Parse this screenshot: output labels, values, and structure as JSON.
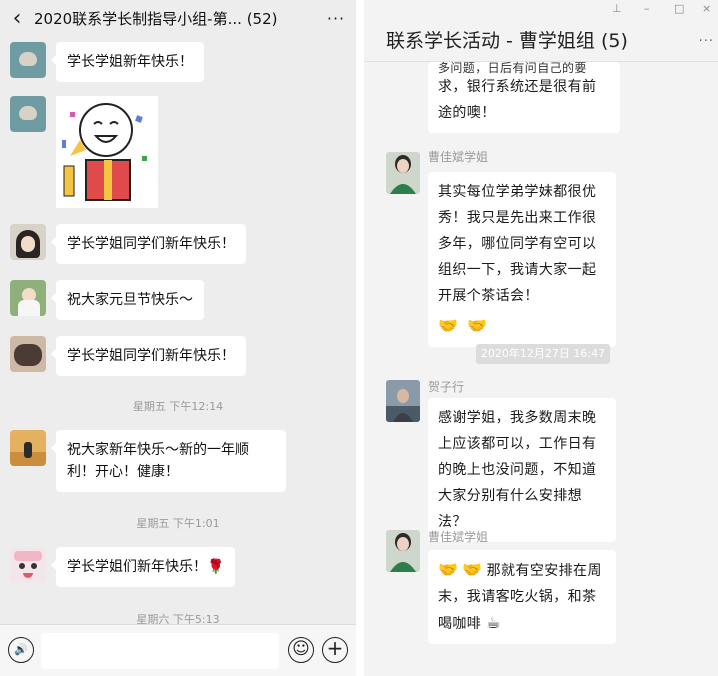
{
  "left": {
    "title": "2020联系学长制指导小组-第...",
    "count": "(52)",
    "back_glyph": "‹",
    "more_glyph": "···",
    "messages": [
      {
        "text": "学长学姐新年快乐！"
      },
      {
        "text": "学长学姐同学们新年快乐！"
      },
      {
        "text": "祝大家元旦节快乐～"
      },
      {
        "text": "学长学姐同学们新年快乐！"
      },
      {
        "text": "祝大家新年快乐～新的一年顺利！开心！健康！"
      },
      {
        "text": "学长学姐们新年快乐！🌹"
      }
    ],
    "timestamps": [
      "星期五 下午12:14",
      "星期五 下午1:01",
      "星期六 下午5:13"
    ],
    "footer": {
      "voice": "🔊",
      "emoji": "☺",
      "plus": "+"
    }
  },
  "right": {
    "title": "联系学长活动 - 曹学姐组 (5)",
    "window_controls": [
      "⊥",
      "–",
      "□",
      "×"
    ],
    "more": "···",
    "partial_bubble": "求，银行系统还是很有前途的噢！",
    "partial_top": "多问题，日后有问自己的要",
    "sender1": "曹佳斌学姐",
    "msg1": "其实每位学弟学妹都很优秀！我只是先出来工作很多年，哪位同学有空可以组织一下，我请大家一起开展个茶话会！",
    "timestamp": "2020年12月27日 16:47",
    "sender2": "贺子行",
    "msg2": "感谢学姐，我多数周末晚上应该都可以，工作日有的晚上也没问题，不知道大家分别有什么安排想法？",
    "sender3": "曹佳斌学姐",
    "msg3": "那就有空安排在周末，我请客吃火锅，和茶喝咖啡",
    "emoji_hands": "🤝",
    "emoji_coffee": "☕"
  }
}
